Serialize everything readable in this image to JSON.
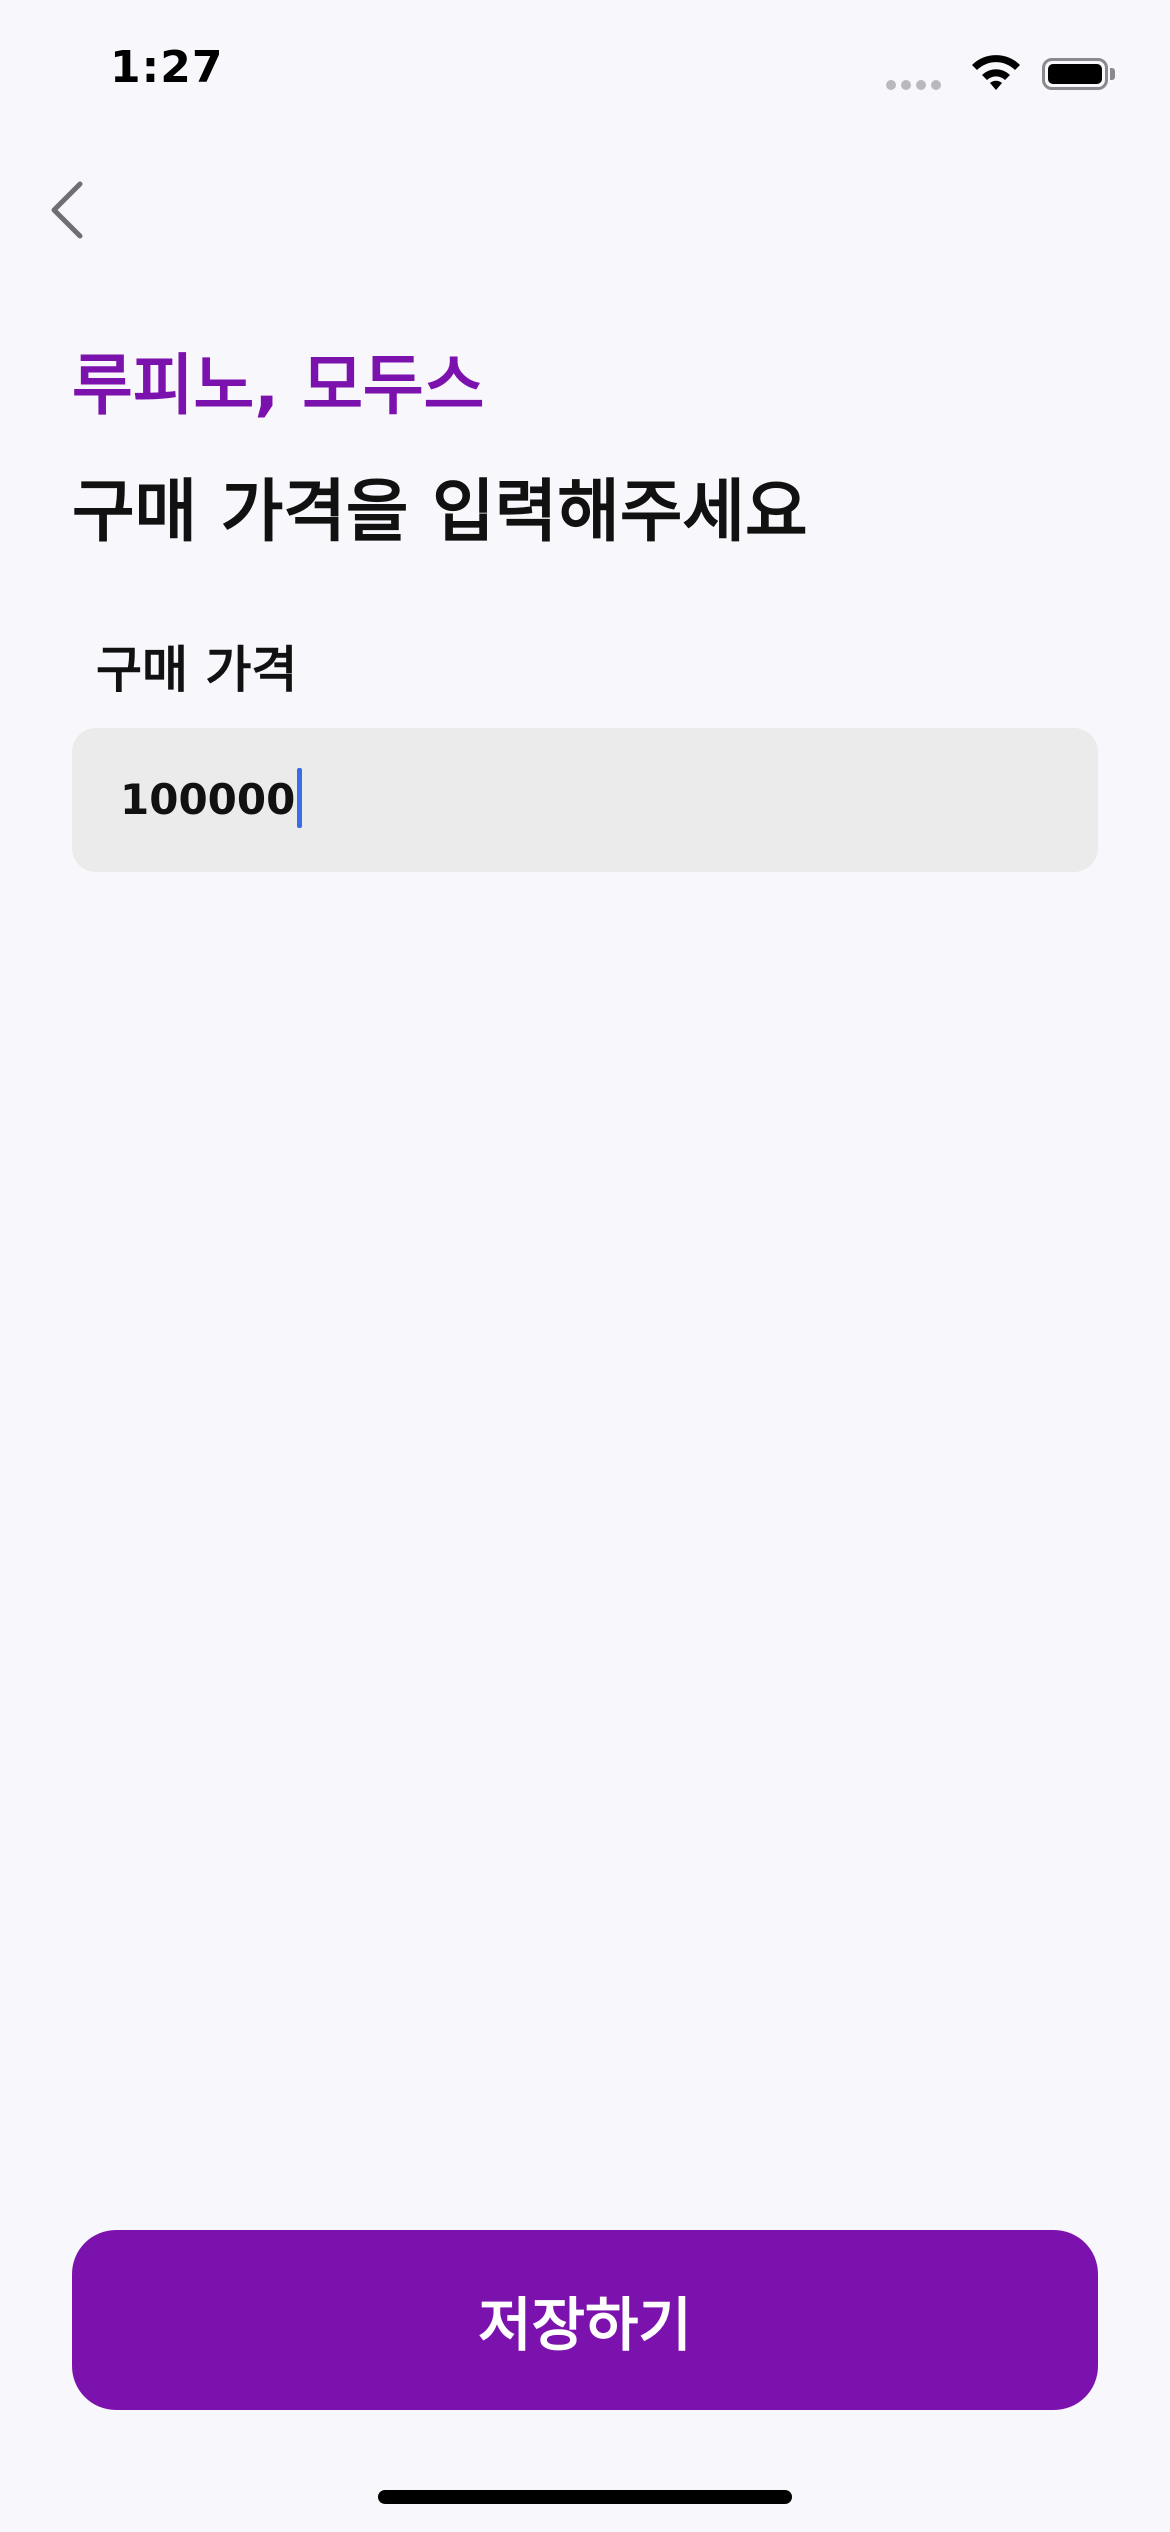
{
  "status_bar": {
    "time": "1:27",
    "icons": [
      "signal-dots-icon",
      "wifi-icon",
      "battery-icon"
    ]
  },
  "nav": {
    "back_icon": "chevron-left-icon"
  },
  "header": {
    "product_name": "루피노, 모두스",
    "title": "구매 가격을 입력해주세요"
  },
  "form": {
    "price_label": "구매 가격",
    "price_value": "100000"
  },
  "actions": {
    "save_label": "저장하기"
  },
  "colors": {
    "accent": "#7c12ae",
    "background": "#f8f7fb",
    "input_background": "#ebebeb",
    "caret": "#3b6ee6"
  }
}
